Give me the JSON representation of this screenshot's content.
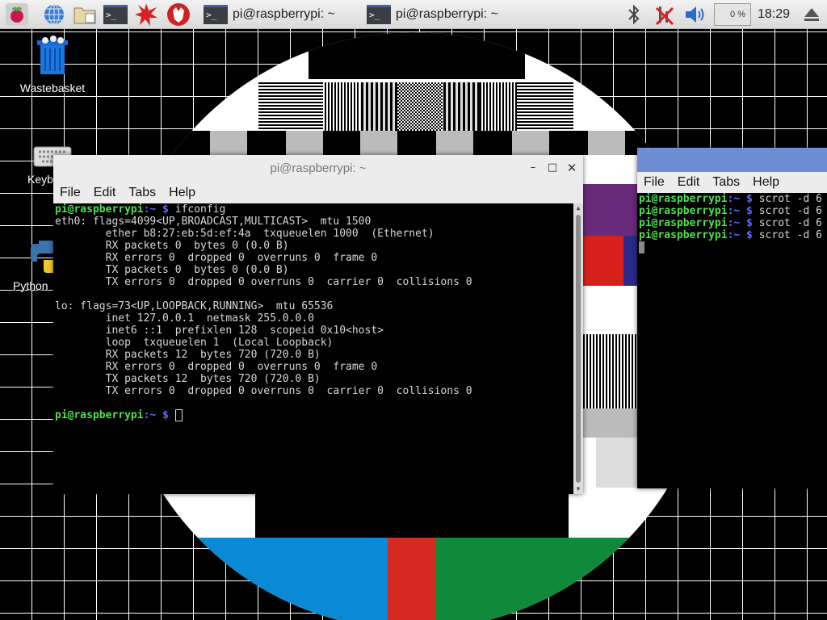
{
  "taskbar": {
    "tasks": [
      {
        "label": "pi@raspberrypi: ~"
      },
      {
        "label": "pi@raspberrypi: ~"
      }
    ],
    "cpu": "0 %",
    "clock": "18:29"
  },
  "desktop": {
    "icons": [
      {
        "label": "Wastebasket",
        "icon": "trash-icon"
      },
      {
        "label": "Keyb",
        "icon": "keyboard-icon"
      },
      {
        "label": "Python",
        "icon": "python-icon"
      }
    ]
  },
  "terminal1": {
    "title": "pi@raspberrypi: ~",
    "menu": [
      "File",
      "Edit",
      "Tabs",
      "Help"
    ],
    "prompt_user": "pi@raspberrypi",
    "prompt_path": ":~ $",
    "command": " ifconfig",
    "output": [
      "eth0: flags=4099<UP,BROADCAST,MULTICAST>  mtu 1500",
      "        ether b8:27:eb:5d:ef:4a  txqueuelen 1000  (Ethernet)",
      "        RX packets 0  bytes 0 (0.0 B)",
      "        RX errors 0  dropped 0  overruns 0  frame 0",
      "        TX packets 0  bytes 0 (0.0 B)",
      "        TX errors 0  dropped 0 overruns 0  carrier 0  collisions 0",
      "",
      "lo: flags=73<UP,LOOPBACK,RUNNING>  mtu 65536",
      "        inet 127.0.0.1  netmask 255.0.0.0",
      "        inet6 ::1  prefixlen 128  scopeid 0x10<host>",
      "        loop  txqueuelen 1  (Local Loopback)",
      "        RX packets 12  bytes 720 (720.0 B)",
      "        RX errors 0  dropped 0  overruns 0  frame 0",
      "        TX packets 12  bytes 720 (720.0 B)",
      "        TX errors 0  dropped 0 overruns 0  carrier 0  collisions 0",
      ""
    ]
  },
  "terminal2": {
    "menu": [
      "File",
      "Edit",
      "Tabs",
      "Help"
    ],
    "prompt_user": "pi@raspberrypi",
    "prompt_path": ":~ $",
    "lines": [
      " scrot -d 6",
      " scrot -d 6",
      " scrot -d 6",
      " scrot -d 6"
    ]
  },
  "colors": {
    "prompt_user": "#4fe04f",
    "prompt_path": "#5c6cff",
    "taskbar_bg": "#e6e6e6"
  }
}
